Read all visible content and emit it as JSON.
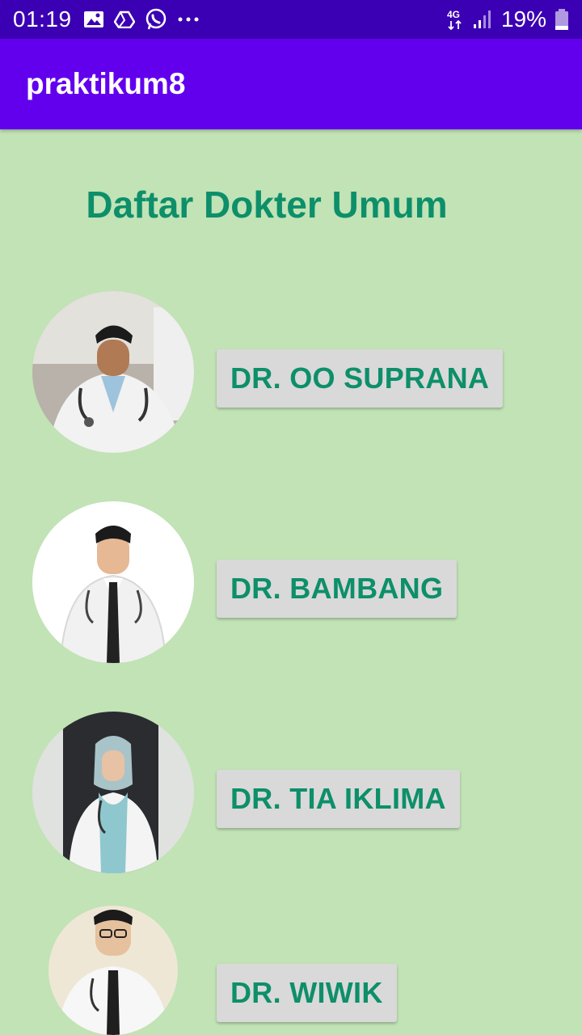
{
  "status_bar": {
    "time": "01:19",
    "network": "4G",
    "battery": "19%",
    "icons": [
      "image-icon",
      "drive-icon",
      "whatsapp-icon",
      "more-dots-icon",
      "signal-icon",
      "battery-icon"
    ]
  },
  "app_bar": {
    "title": "praktikum8"
  },
  "main": {
    "heading": "Daftar Dokter Umum",
    "doctors": [
      {
        "name": "DR. OO SUPRANA"
      },
      {
        "name": "DR. BAMBANG"
      },
      {
        "name": "DR. TIA IKLIMA"
      },
      {
        "name": "DR. WIWIK"
      }
    ]
  },
  "colors": {
    "status_bar": "#3b00b3",
    "app_bar": "#6200ee",
    "background": "#c1e3b5",
    "accent_text": "#0d8f6a",
    "button_bg": "#d9d9d9"
  }
}
